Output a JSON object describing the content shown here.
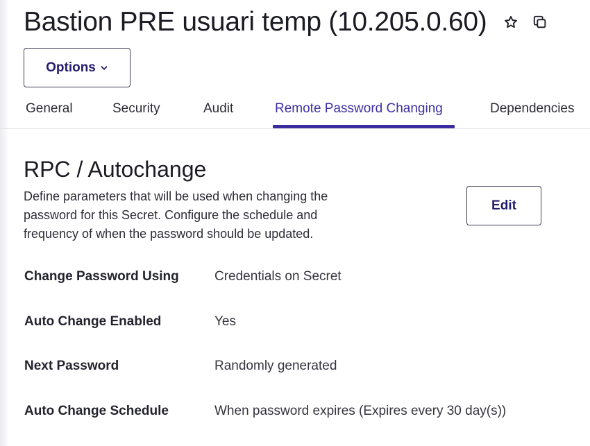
{
  "header": {
    "title": "Bastion PRE usuari temp (10.205.0.60)",
    "star_icon": "star-outline-icon",
    "copy_icon": "copy-icon"
  },
  "options_button": {
    "label": "Options",
    "icon": "chevron-down-icon"
  },
  "tabs": [
    {
      "label": "General",
      "active": false
    },
    {
      "label": "Security",
      "active": false
    },
    {
      "label": "Audit",
      "active": false
    },
    {
      "label": "Remote Password Changing",
      "active": true
    },
    {
      "label": "Dependencies",
      "active": false
    }
  ],
  "section": {
    "title": "RPC / Autochange",
    "description_lines": [
      "Define parameters that will be used when changing the",
      "password for this Secret. Configure the schedule and",
      "frequency of when the password should be updated."
    ],
    "edit_label": "Edit"
  },
  "fields": [
    {
      "label": "Change Password Using",
      "value": "Credentials on Secret"
    },
    {
      "label": "Auto Change Enabled",
      "value": "Yes"
    },
    {
      "label": "Next Password",
      "value": "Randomly generated"
    },
    {
      "label": "Auto Change Schedule",
      "value": "When password expires (Expires every 30 day(s))"
    }
  ],
  "colors": {
    "accent": "#3b2ca0",
    "button_text": "#241c6e",
    "text": "#1f1f2e"
  }
}
